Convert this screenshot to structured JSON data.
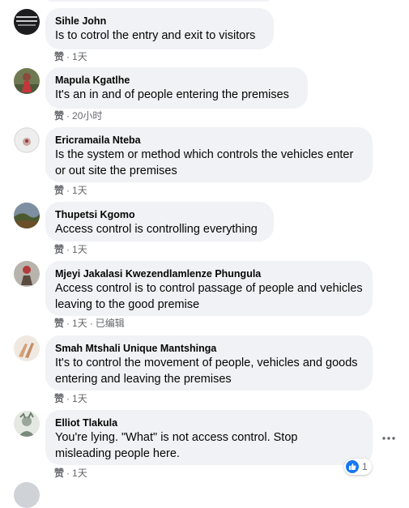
{
  "comments": [
    {
      "author": "Sihle John",
      "text": "Is to cotrol the entry and exit to visitors",
      "like_label": "赞",
      "time": "1天",
      "edited": ""
    },
    {
      "author": "Mapula Kgatlhe",
      "text": "It's an in and of people entering the premises",
      "like_label": "赞",
      "time": "20小时",
      "edited": ""
    },
    {
      "author": "Ericramaila Nteba",
      "text": "Is the system or method which controls the vehicles enter or out site the premises",
      "like_label": "赞",
      "time": "1天",
      "edited": ""
    },
    {
      "author": "Thupetsi Kgomo",
      "text": "Access control is controlling everything",
      "like_label": "赞",
      "time": "1天",
      "edited": ""
    },
    {
      "author": "Mjeyi Jakalasi Kwezendlamlenze Phungula",
      "text": "Access control is to control passage of people and vehicles leaving to the good premise",
      "like_label": "赞",
      "time": "1天",
      "edited": "已编辑"
    },
    {
      "author": "Smah Mtshali Unique Mantshinga",
      "text": "It's to control the movement of people, vehicles and goods entering and leaving the premises",
      "like_label": "赞",
      "time": "1天",
      "edited": ""
    },
    {
      "author": "Elliot Tlakula",
      "text": "You're lying. \"What\" is not access control. Stop misleading people here.",
      "like_label": "赞",
      "time": "1天",
      "edited": "",
      "reaction_count": "1"
    }
  ],
  "colors": {
    "bubble": "#f0f2f5",
    "meta": "#65676b",
    "like_blue": "#1877f2"
  },
  "icons": {
    "more": "more-options-icon",
    "reaction": "thumbs-up-icon"
  }
}
